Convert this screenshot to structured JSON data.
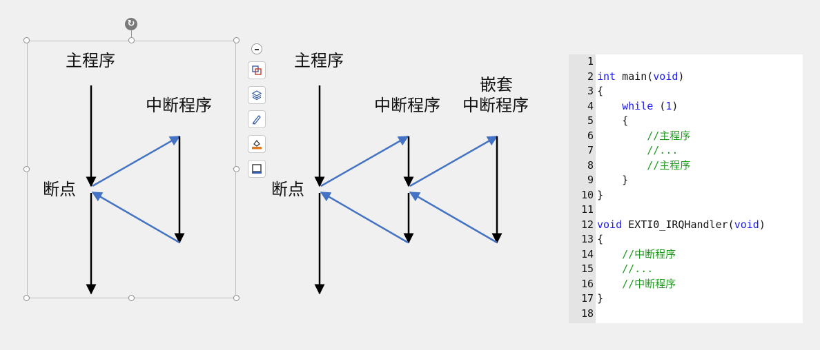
{
  "diagram_left": {
    "main_program_label": "主程序",
    "interrupt_program_label": "中断程序",
    "breakpoint_label": "断点"
  },
  "diagram_right": {
    "main_program_label": "主程序",
    "interrupt_program_label": "中断程序",
    "nested_label_line1": "嵌套",
    "nested_label_line2": "中断程序",
    "breakpoint_label": "断点"
  },
  "colors": {
    "arrow_blue": "#4472c4",
    "arrow_black": "#000000",
    "comment_green": "#1f9a1f",
    "keyword_blue": "#1a1aee",
    "gutter_gray": "#e4e4e4"
  },
  "toolbar": {
    "rotate_icon": "rotate-icon",
    "collapse_icon": "minus-circle-icon",
    "tools": [
      "crop-icon",
      "layers-icon",
      "pen-icon",
      "fill-icon",
      "frame-icon"
    ]
  },
  "code": {
    "lines": [
      {
        "n": "1",
        "fold": "",
        "parts": []
      },
      {
        "n": "2",
        "fold": "",
        "parts": [
          {
            "t": "int",
            "c": "kw"
          },
          {
            "t": " main(",
            "c": ""
          },
          {
            "t": "void",
            "c": "kw"
          },
          {
            "t": ")",
            "c": ""
          }
        ]
      },
      {
        "n": "3",
        "fold": "",
        "parts": [
          {
            "t": "{",
            "c": ""
          }
        ]
      },
      {
        "n": "4",
        "fold": "",
        "parts": [
          {
            "t": "    ",
            "c": ""
          },
          {
            "t": "while",
            "c": "kw"
          },
          {
            "t": " (",
            "c": ""
          },
          {
            "t": "1",
            "c": "num"
          },
          {
            "t": ")",
            "c": ""
          }
        ]
      },
      {
        "n": "5",
        "fold": "",
        "parts": [
          {
            "t": "    {",
            "c": ""
          }
        ]
      },
      {
        "n": "6",
        "fold": "",
        "parts": [
          {
            "t": "        ",
            "c": ""
          },
          {
            "t": "//主程序",
            "c": "cm"
          }
        ]
      },
      {
        "n": "7",
        "fold": "",
        "parts": [
          {
            "t": "        ",
            "c": ""
          },
          {
            "t": "//...",
            "c": "cm"
          }
        ]
      },
      {
        "n": "8",
        "fold": "",
        "parts": [
          {
            "t": "        ",
            "c": ""
          },
          {
            "t": "//主程序",
            "c": "cm"
          }
        ]
      },
      {
        "n": "9",
        "fold": "",
        "parts": [
          {
            "t": "    }",
            "c": ""
          }
        ]
      },
      {
        "n": "10",
        "fold": "",
        "parts": [
          {
            "t": "}",
            "c": ""
          }
        ]
      },
      {
        "n": "11",
        "fold": "",
        "parts": []
      },
      {
        "n": "12",
        "fold": "",
        "parts": [
          {
            "t": "void",
            "c": "kw"
          },
          {
            "t": " EXTI0_IRQHandler(",
            "c": ""
          },
          {
            "t": "void",
            "c": "kw"
          },
          {
            "t": ")",
            "c": ""
          }
        ]
      },
      {
        "n": "13",
        "fold": "",
        "parts": [
          {
            "t": "{",
            "c": ""
          }
        ]
      },
      {
        "n": "14",
        "fold": "",
        "parts": [
          {
            "t": "    ",
            "c": ""
          },
          {
            "t": "//中断程序",
            "c": "cm"
          }
        ]
      },
      {
        "n": "15",
        "fold": "",
        "parts": [
          {
            "t": "    ",
            "c": ""
          },
          {
            "t": "//...",
            "c": "cm"
          }
        ]
      },
      {
        "n": "16",
        "fold": "",
        "parts": [
          {
            "t": "    ",
            "c": ""
          },
          {
            "t": "//中断程序",
            "c": "cm"
          }
        ]
      },
      {
        "n": "17",
        "fold": "",
        "parts": [
          {
            "t": "}",
            "c": ""
          }
        ]
      },
      {
        "n": "18",
        "fold": "",
        "parts": []
      }
    ]
  }
}
